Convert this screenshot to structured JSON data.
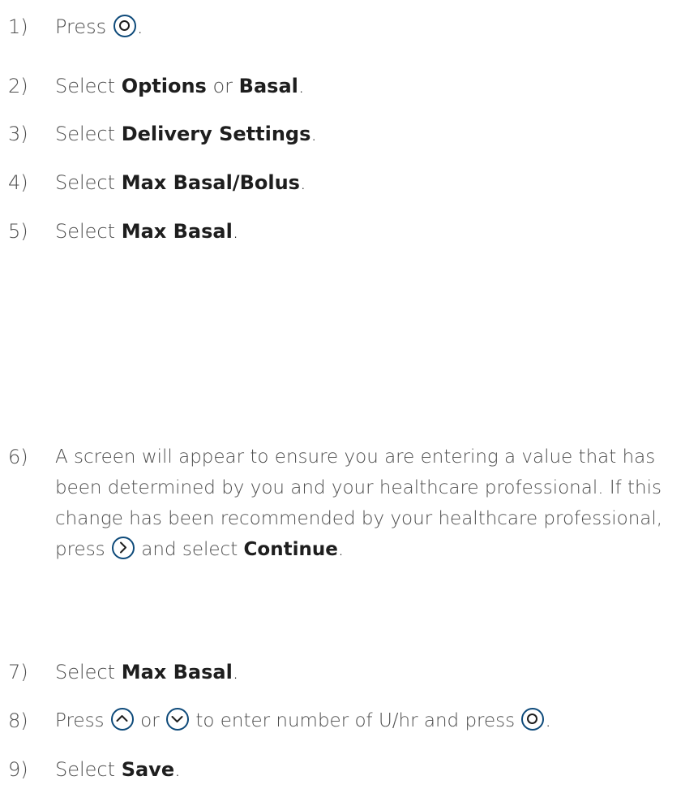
{
  "steps": [
    {
      "num": "1)",
      "pre": "Press",
      "post": "."
    },
    {
      "num": "2)",
      "pre": "Select",
      "b1": "Options",
      "mid": "or",
      "b2": "Basal",
      "post": "."
    },
    {
      "num": "3)",
      "pre": "Select",
      "b1": "Delivery Settings",
      "post": "."
    },
    {
      "num": "4)",
      "pre": "Select",
      "b1": "Max Basal/Bolus",
      "post": "."
    },
    {
      "num": "5)",
      "pre": "Select",
      "b1": "Max Basal",
      "post": "."
    },
    {
      "num": "6)",
      "text": "A screen will appear to ensure you are entering a value that has been determined by you and your healthcare professional. If this change has been recommended by your healthcare professional,  press",
      "mid": "and select",
      "b1": "Continue",
      "post": "."
    },
    {
      "num": "7)",
      "pre": "Select",
      "b1": "Max Basal",
      "post": "."
    },
    {
      "num": "8)",
      "pre": "Press",
      "or": "or",
      "mid": "to enter number of U/hr and press",
      "post": "."
    },
    {
      "num": "9)",
      "pre": "Select",
      "b1": "Save",
      "post": "."
    }
  ],
  "icons": {
    "select": "select-button-icon",
    "right": "right-arrow-button-icon",
    "up": "up-arrow-button-icon",
    "down": "down-arrow-button-icon"
  },
  "colors": {
    "icon_ring": "#0e4a7a",
    "text": "#4d4d4d",
    "bold": "#1e1e1e"
  }
}
